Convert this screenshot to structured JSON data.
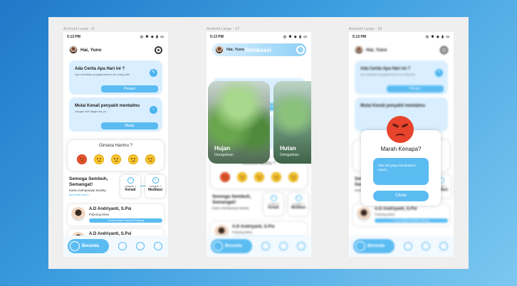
{
  "frames": [
    {
      "label": "Android Large - 8"
    },
    {
      "label": "Android Large - 17"
    },
    {
      "label": "Android Large - 18"
    }
  ],
  "status": {
    "time": "5:13 PM",
    "icons": "◷ ✱ ◈ ▮ ▭"
  },
  "header": {
    "greeting": "Hai, Yuno",
    "relax_title": "Relaksasi"
  },
  "cards": [
    {
      "title": "Ada Cerita Apa Hari ini ?",
      "subtitle": "Ayo ceritakan pengalamanmu ke orang lain",
      "button": "Pesan",
      "icon": "pencil-icon"
    },
    {
      "title": "Mulai Kenali penyakit mentalmu",
      "subtitle": "Jangan self diagnosis ya",
      "button": "Mulai",
      "icon": "arrow-icon"
    }
  ],
  "mood": {
    "question": "Gimana Harimu ?"
  },
  "healing": {
    "title": "Semoga Sembuh, Semangat!",
    "subtitle": "Kamu mempunyai anxiety",
    "link": "Baca lebih lanjut >",
    "steps": [
      {
        "small": "Langkah 1",
        "label": "Kenali"
      },
      {
        "small": "Langkah 2",
        "label": "Meditasi"
      }
    ]
  },
  "psychologists": [
    {
      "name": "A.D Andriyanti, S.Psi",
      "role": "Psikolog klinis",
      "button": "Curah dengan Pasukan Psikolog"
    },
    {
      "name": "A.D Andriyanti, S.Psi",
      "role": "Psikolog klinis",
      "button": "Curah dengan Pasukan Psikolog"
    }
  ],
  "nav": {
    "home": "Beranda"
  },
  "relax": [
    {
      "title": "Hujan",
      "subtitle": "Dengarkan"
    },
    {
      "title": "Hutan",
      "subtitle": "Dengarkan"
    }
  ],
  "modal": {
    "title": "Marah Kenapa?",
    "placeholder": "Tulis hal yang membuatmu marah...",
    "close": "Close"
  }
}
